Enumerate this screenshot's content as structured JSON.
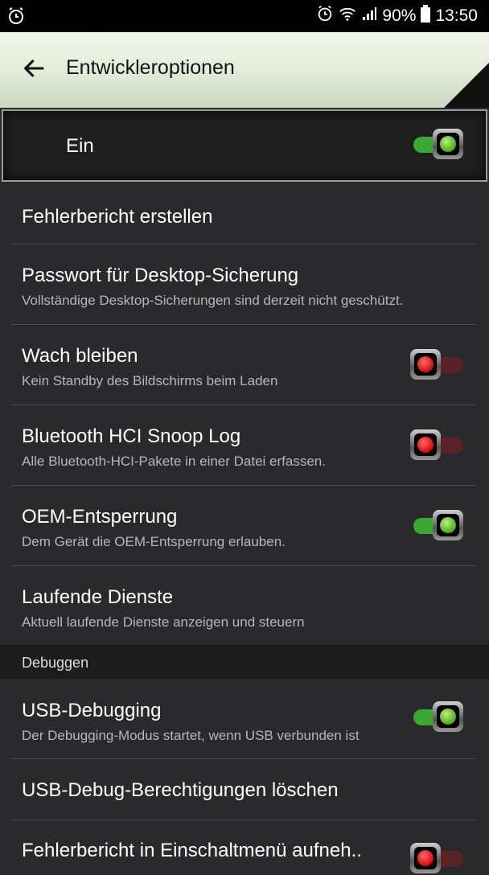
{
  "status_bar": {
    "battery_percent": "90%",
    "time": "13:50",
    "icons": [
      "alarm-icon",
      "alarm-clock-icon",
      "wifi-icon",
      "signal-icon",
      "battery-icon"
    ]
  },
  "app_bar": {
    "title": "Entwickleroptionen",
    "back_icon": "arrow-left-icon"
  },
  "master_switch": {
    "label": "Ein",
    "on": true
  },
  "items": [
    {
      "title": "Fehlerbericht erstellen",
      "subtitle": ""
    },
    {
      "title": "Passwort für Desktop-Sicherung",
      "subtitle": "Vollständige Desktop-Sicherungen sind derzeit nicht geschützt."
    },
    {
      "title": "Wach bleiben",
      "subtitle": "Kein Standby des Bildschirms beim Laden",
      "toggle": false
    },
    {
      "title": "Bluetooth HCI Snoop Log",
      "subtitle": "Alle Bluetooth-HCI-Pakete in einer Datei erfassen.",
      "toggle": false
    },
    {
      "title": "OEM-Entsperrung",
      "subtitle": "Dem Gerät die OEM-Entsperrung erlauben.",
      "toggle": true
    },
    {
      "title": "Laufende Dienste",
      "subtitle": "Aktuell laufende Dienste anzeigen und steuern"
    }
  ],
  "section_header": "Debuggen",
  "debug_items": [
    {
      "title": "USB-Debugging",
      "subtitle": "Der Debugging-Modus startet, wenn USB verbunden ist",
      "toggle": true
    },
    {
      "title": "USB-Debug-Berechtigungen löschen",
      "subtitle": ""
    },
    {
      "title": "Fehlerbericht in Einschaltmenü aufneh..",
      "subtitle": "",
      "toggle": false
    }
  ],
  "colors": {
    "accent_on": "#3aa833",
    "accent_off": "#e01616",
    "background": "#2a2a2c"
  }
}
